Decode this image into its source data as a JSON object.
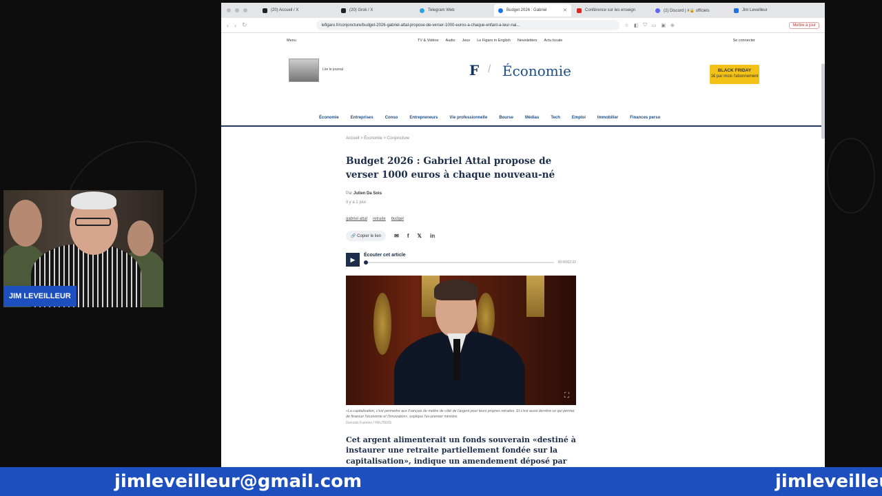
{
  "browser": {
    "tabs": [
      {
        "label": "(20) Accueil / X",
        "color": "#222222"
      },
      {
        "label": "(20) Grok / X",
        "color": "#222222"
      },
      {
        "label": "Telegram Web",
        "color": "#2aa3e0"
      },
      {
        "label": "Budget 2026 : Gabriel",
        "color": "#1a73e8"
      },
      {
        "label": "Conférence sur les enseign",
        "color": "#e62117"
      },
      {
        "label": "(2) Discord | #🔒 officiels",
        "color": "#5865f2"
      },
      {
        "label": "Jim Leveilleur",
        "color": "#1a73e8"
      }
    ],
    "url": "lefigaro.fr/conjoncture/budget-2026-gabriel-attal-propose-de-verser-1000-euros-a-chaque-enfant-a-leur-nai...",
    "update_label": "Mettre à jour"
  },
  "site": {
    "topnav": {
      "menu": "Menu",
      "items": [
        "TV & Vidéos",
        "Audio",
        "Jeux",
        "Le Figaro in English",
        "Newsletters",
        "Actu locale"
      ],
      "login": "Se connecter"
    },
    "journal_label": "Lire le journal",
    "logo": "F",
    "section": "Économie",
    "promo_title": "BLACK FRIDAY",
    "promo_sub": "1€ par mois l'abonnement",
    "categories": [
      "Économie",
      "Entreprises",
      "Conso",
      "Entrepreneurs",
      "Vie professionnelle",
      "Bourse",
      "Médias",
      "Tech",
      "Emploi",
      "Immobilier",
      "Finances perso"
    ]
  },
  "article": {
    "breadcrumb": "Accueil > Économie > Conjoncture",
    "title": "Budget 2026 : Gabriel Attal propose de verser 1000 euros à chaque nouveau-né",
    "author_prefix": "Par",
    "author": "Julien Da Sois",
    "date": "Il y a 1 jour",
    "tags": [
      "gabriel attal",
      "retraite",
      "budget"
    ],
    "copy_link": "Copier le lien",
    "audio_label": "Écouter cet article",
    "audio_time": "00:00/02:22",
    "audio_progress": 0,
    "caption": "«La capitalisation, c'est permettre aux Français de mettre de côté de l'argent pour leurs propres retraites. Et c'est aussi derrière ce qui permet de financer l'économie et l'innovation», explique l'ex-premier ministre.",
    "credit": "Gonzalo Fuentes / REUTERS",
    "body": "Cet argent alimenterait un fonds souverain «destiné à instaurer une retraite partiellement fondée sur la capitalisation», indique un amendement déposé par des députés du groupe Ensemble pour la République (EPR), présidé par l'ex-premier ministre."
  },
  "overlay": {
    "name": "JIM LEVEILLEUR",
    "email": "jimleveilleur@gmail.com",
    "accent": "#1d4fbf"
  }
}
